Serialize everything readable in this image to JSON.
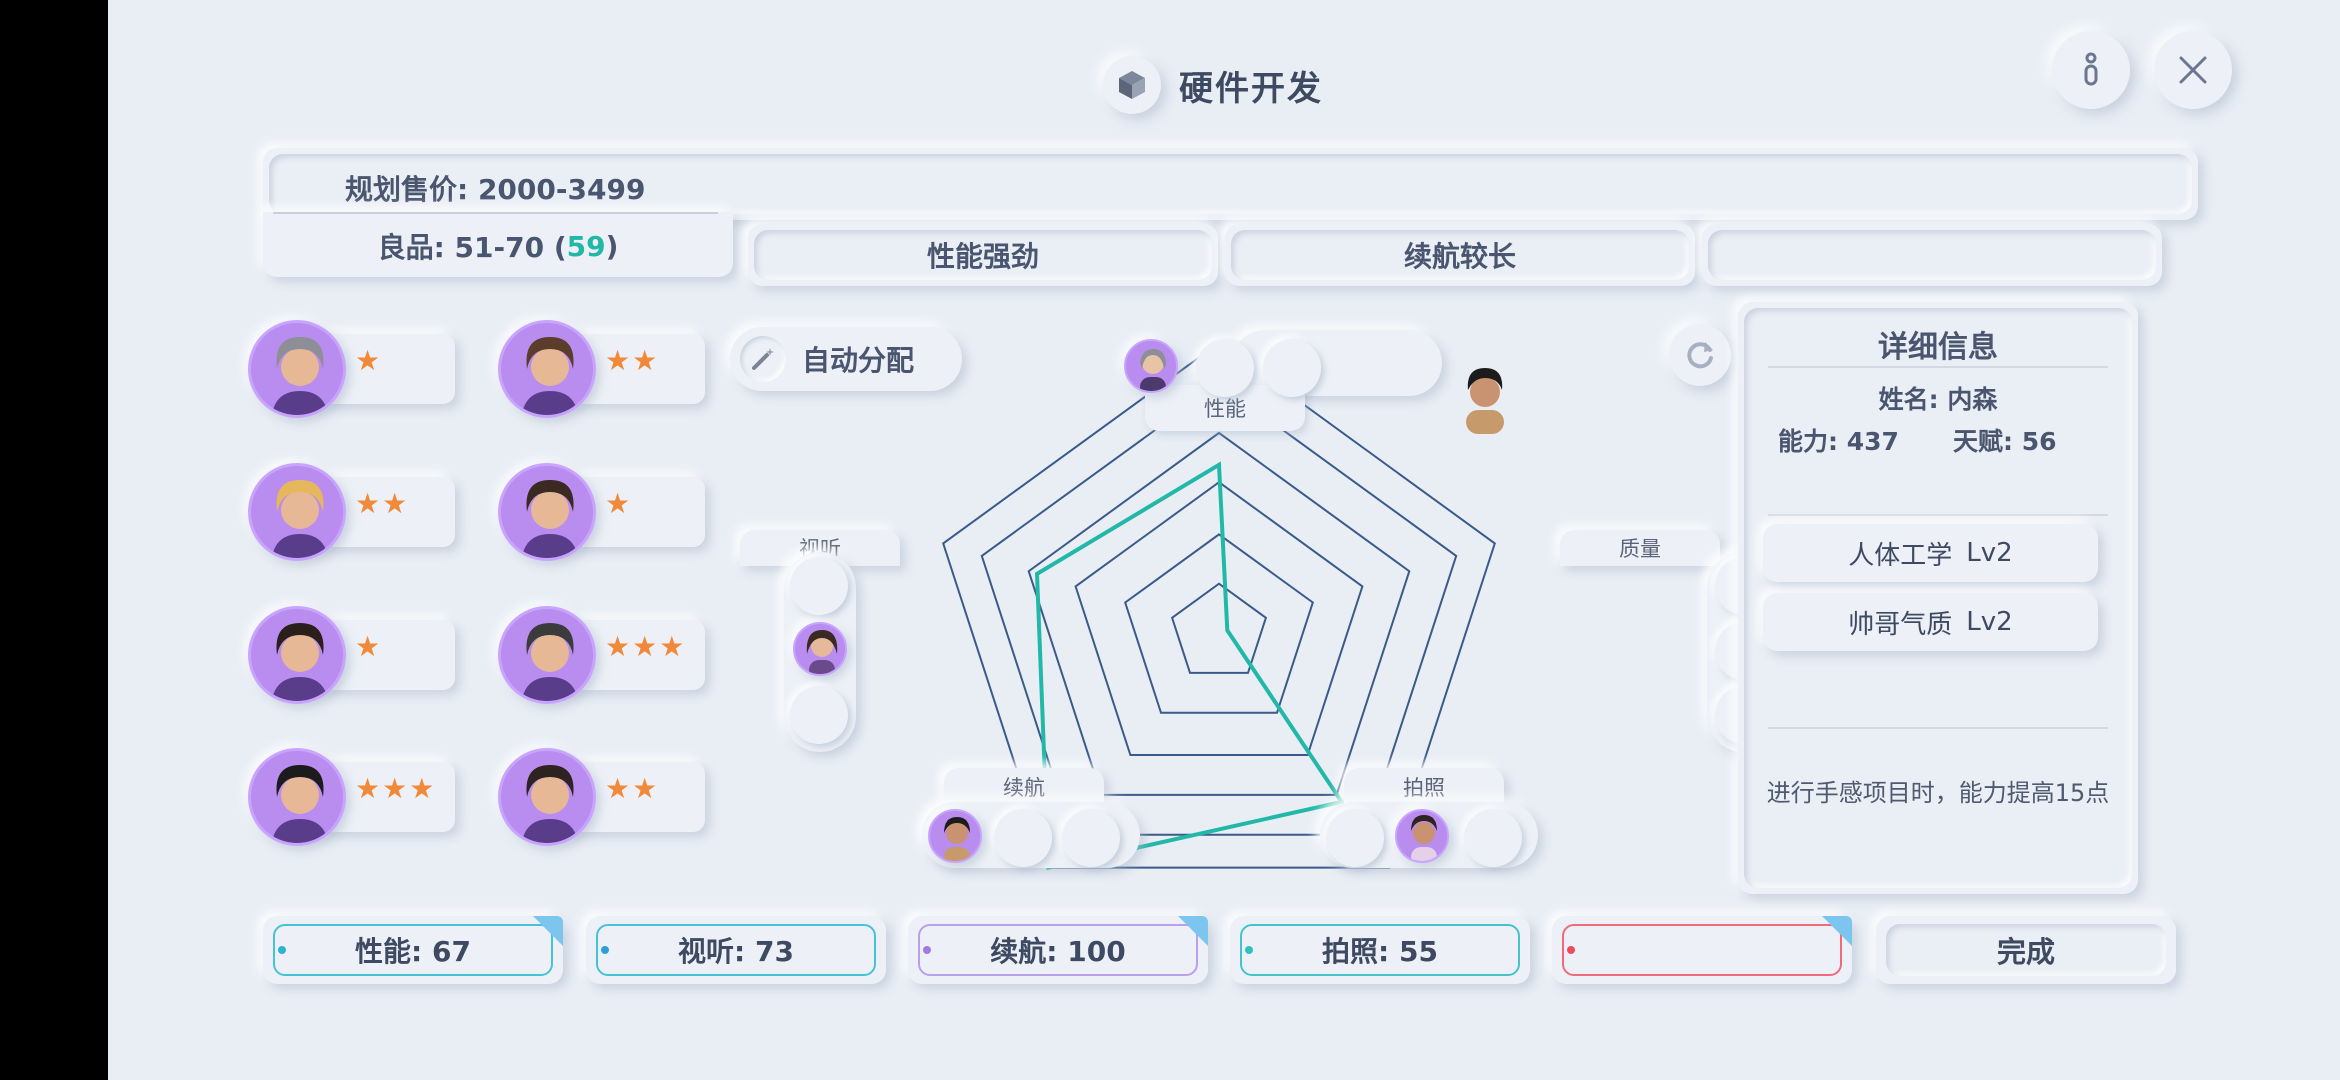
{
  "header": {
    "title": "硬件开发"
  },
  "plan": {
    "price_label": "规划售价: 2000-3499",
    "quality_prefix": "良品: 51-70 (",
    "quality_value": "59",
    "quality_suffix": ")"
  },
  "features": [
    "性能强劲",
    "续航较长",
    ""
  ],
  "auto_assign_label": "自动分配",
  "employees": [
    {
      "stars": "★",
      "color": "#8e8e96"
    },
    {
      "stars": "★★",
      "color": "#5a3d2b"
    },
    {
      "stars": "★★",
      "color": "#e7b85b"
    },
    {
      "stars": "★",
      "color": "#3a2a22"
    },
    {
      "stars": "★",
      "color": "#2a1f1a"
    },
    {
      "stars": "★★★",
      "color": "#3b3b3b"
    },
    {
      "stars": "★★★",
      "color": "#1c1c1c"
    },
    {
      "stars": "★★",
      "color": "#2d2320"
    }
  ],
  "radar": {
    "labels": {
      "performance": "性能",
      "audio": "视听",
      "quality": "质量",
      "battery": "续航",
      "camera": "拍照"
    }
  },
  "detail": {
    "title": "详细信息",
    "name": "姓名: 内森",
    "ability": "能力: 437",
    "talent": "天赋: 56",
    "skills": [
      {
        "name": "人体工学",
        "level": "Lv2"
      },
      {
        "name": "帅哥气质",
        "level": "Lv2"
      }
    ],
    "description": "进行手感项目时，能力提高15点"
  },
  "stats": [
    {
      "label": "性能: 67",
      "border": "#45c3d6",
      "dot": "#2bb3d6",
      "corner": true
    },
    {
      "label": "视听: 73",
      "border": "#45c3d6",
      "dot": "#2b9fd6",
      "corner": false
    },
    {
      "label": "续航: 100",
      "border": "#b9a0e8",
      "dot": "#a07be0",
      "corner": true
    },
    {
      "label": "拍照: 55",
      "border": "#45c3c8",
      "dot": "#2bc3c0",
      "corner": false
    },
    {
      "label": "",
      "border": "#ef6b7a",
      "dot": "#ef4b5a",
      "corner": true
    }
  ],
  "done_label": "完成",
  "colors": {
    "accent_teal": "#22b8a8",
    "radar_line": "#3a5a8a",
    "star": "#f08a3a",
    "avatar_bg": "#b98cf0"
  },
  "icons": {
    "title": "cube-icon",
    "info": "info-icon",
    "close": "close-icon",
    "auto": "magic-wand-icon",
    "refresh": "refresh-icon"
  }
}
